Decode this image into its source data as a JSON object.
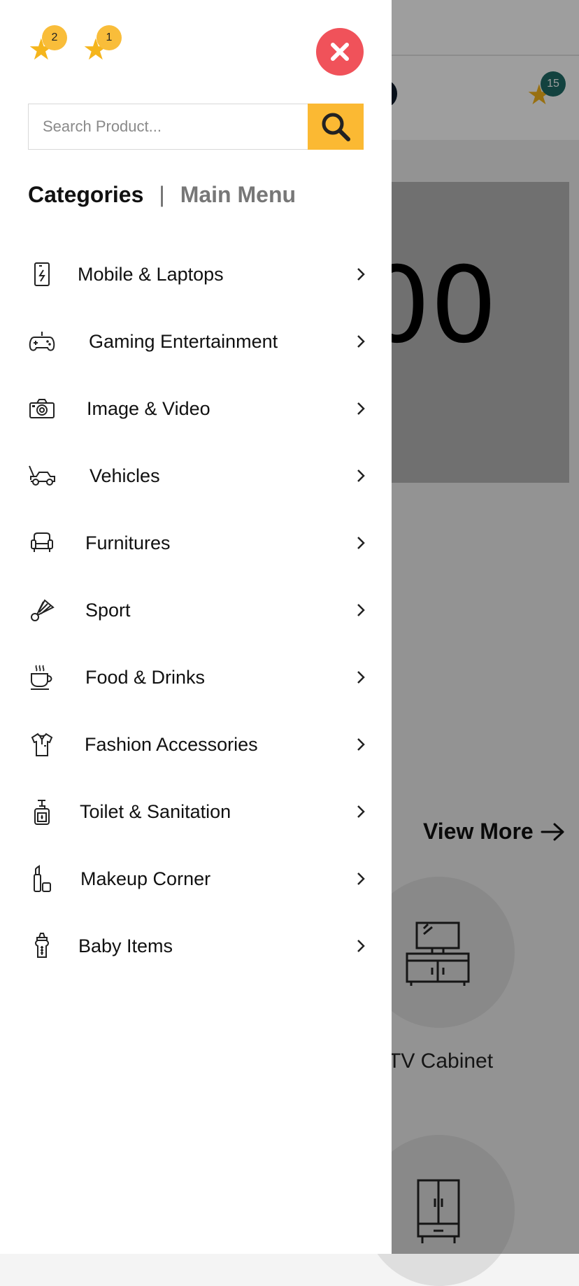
{
  "header": {
    "favorites": [
      {
        "icon": "star-icon",
        "count": "2"
      },
      {
        "icon": "star-icon",
        "count": "1"
      }
    ],
    "close_icon": "close-icon"
  },
  "search": {
    "placeholder": "Search Product...",
    "button_icon": "search-icon"
  },
  "menu_tabs": {
    "active": "Categories",
    "separator": "|",
    "inactive": "Main Menu"
  },
  "categories": [
    {
      "label": "Mobile & Laptops",
      "icon": "mobile-icon"
    },
    {
      "label": "Gaming Entertainment",
      "icon": "gamepad-icon"
    },
    {
      "label": "Image & Video",
      "icon": "camera-icon"
    },
    {
      "label": "Vehicles",
      "icon": "car-icon"
    },
    {
      "label": "Furnitures",
      "icon": "armchair-icon"
    },
    {
      "label": "Sport",
      "icon": "shuttlecock-icon"
    },
    {
      "label": "Food & Drinks",
      "icon": "coffee-cup-icon"
    },
    {
      "label": "Fashion Accessories",
      "icon": "shirt-icon"
    },
    {
      "label": "Toilet & Sanitation",
      "icon": "soap-bottle-icon"
    },
    {
      "label": "Makeup Corner",
      "icon": "lipstick-icon"
    },
    {
      "label": "Baby Items",
      "icon": "baby-bottle-icon"
    }
  ],
  "background": {
    "banner_text": "00",
    "view_more": "View More",
    "item_caption": "TV Cabinet",
    "cart_count": "15"
  },
  "colors": {
    "accent": "#fbb933",
    "close": "#f0525a",
    "star": "#f5b51c"
  }
}
